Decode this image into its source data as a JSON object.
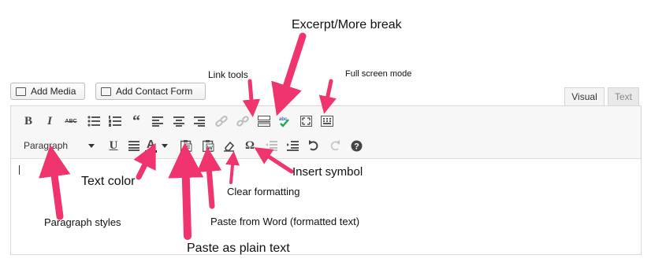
{
  "buttons": {
    "add_media": "Add Media",
    "add_contact_form": "Add Contact Form"
  },
  "tabs": {
    "visual": "Visual",
    "text": "Text"
  },
  "toolbar": {
    "row1": {
      "bold": "B",
      "italic": "I",
      "strikethrough": "ABC",
      "blockquote": "“",
      "symbols_hint": "Ω"
    },
    "row2": {
      "format_select": "Paragraph",
      "underline": "U",
      "text_color": "A",
      "special_char": "Ω"
    }
  },
  "annotations": {
    "excerpt_more_break": "Excerpt/More break",
    "link_tools": "Link tools",
    "full_screen_mode": "Full screen mode",
    "text_color": "Text color",
    "insert_symbol": "Insert symbol",
    "clear_formatting": "Clear formatting",
    "paragraph_styles": "Paragraph styles",
    "paste_from_word": "Paste from Word (formatted text)",
    "paste_as_plain_text": "Paste as plain text"
  },
  "colors": {
    "arrow": "#f0346e",
    "tab_active_bg": "#f4f4f4",
    "tab_inactive_bg": "#e9e9e9",
    "toolbar_bg": "#f7f7f7",
    "proofread_check": "#21a64a",
    "proofread_abc": "#2a6cc4"
  },
  "icons": {
    "row1": [
      "bold-icon",
      "italic-icon",
      "strikethrough-icon",
      "bullet-list-icon",
      "numbered-list-icon",
      "blockquote-icon",
      "align-left-icon",
      "align-center-icon",
      "align-right-icon",
      "insert-link-icon",
      "remove-link-icon",
      "read-more-icon",
      "proofread-icon",
      "fullscreen-icon",
      "toolbar-toggle-icon"
    ],
    "row2": [
      "underline-icon",
      "justify-icon",
      "text-color-icon",
      "paste-text-icon",
      "paste-word-icon",
      "clear-formatting-icon",
      "special-character-icon",
      "outdent-icon",
      "indent-icon",
      "undo-icon",
      "redo-icon",
      "help-icon"
    ]
  }
}
